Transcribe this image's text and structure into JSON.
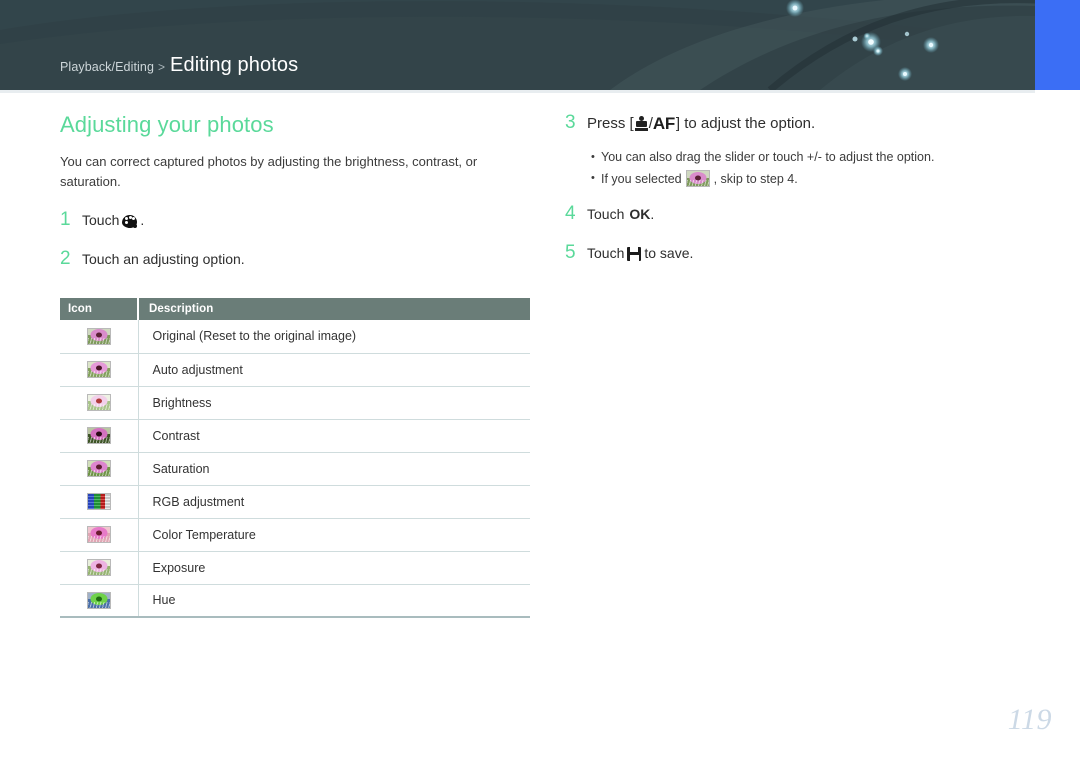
{
  "header": {
    "breadcrumb_path": "Playback/Editing",
    "breadcrumb_separator": ">",
    "breadcrumb_title": "Editing photos",
    "accent_blue": "#3b6ef5",
    "band_color": "#334449"
  },
  "main": {
    "section_title": "Adjusting your photos",
    "intro": "You can correct captured photos by adjusting the brightness, contrast, or saturation.",
    "title_color": "#5ad99a"
  },
  "steps_left": [
    {
      "number": "1",
      "text_before": "Touch",
      "icon": "palette-icon",
      "text_after": "."
    },
    {
      "number": "2",
      "text_before": "Touch an adjusting option.",
      "icon": "",
      "text_after": ""
    }
  ],
  "steps_right": [
    {
      "number": "3",
      "text_before": "Press [",
      "icon": "camera-af-icon",
      "text_after": "] to adjust the option."
    },
    {
      "number": "4",
      "text_before": "Touch",
      "bold": "OK",
      "text_after": "."
    },
    {
      "number": "5",
      "text_before": "Touch",
      "icon": "save-icon",
      "text_after": "to save."
    }
  ],
  "bullets": [
    {
      "text_before": "You can also drag the slider or touch +/- to adjust the option.",
      "icon": "",
      "text_after": ""
    },
    {
      "text_before": "If you selected",
      "icon": "thumbnail-original",
      "text_after": ", skip to step 4."
    }
  ],
  "af_label": "AF",
  "table": {
    "headers": [
      "Icon",
      "Description"
    ],
    "header_bg": "#6a7d78",
    "rows": [
      {
        "icon": "thumbnail-original",
        "description": "Original (Reset to the original image)"
      },
      {
        "icon": "thumbnail-auto-adjustment",
        "description": "Auto adjustment"
      },
      {
        "icon": "thumbnail-brightness",
        "description": "Brightness"
      },
      {
        "icon": "thumbnail-contrast",
        "description": "Contrast"
      },
      {
        "icon": "thumbnail-saturation",
        "description": "Saturation"
      },
      {
        "icon": "thumbnail-rgb-adjustment",
        "description": "RGB adjustment"
      },
      {
        "icon": "thumbnail-color-temperature",
        "description": "Color Temperature"
      },
      {
        "icon": "thumbnail-exposure",
        "description": "Exposure"
      },
      {
        "icon": "thumbnail-hue",
        "description": "Hue"
      }
    ]
  },
  "footer": {
    "page_number": "119"
  }
}
